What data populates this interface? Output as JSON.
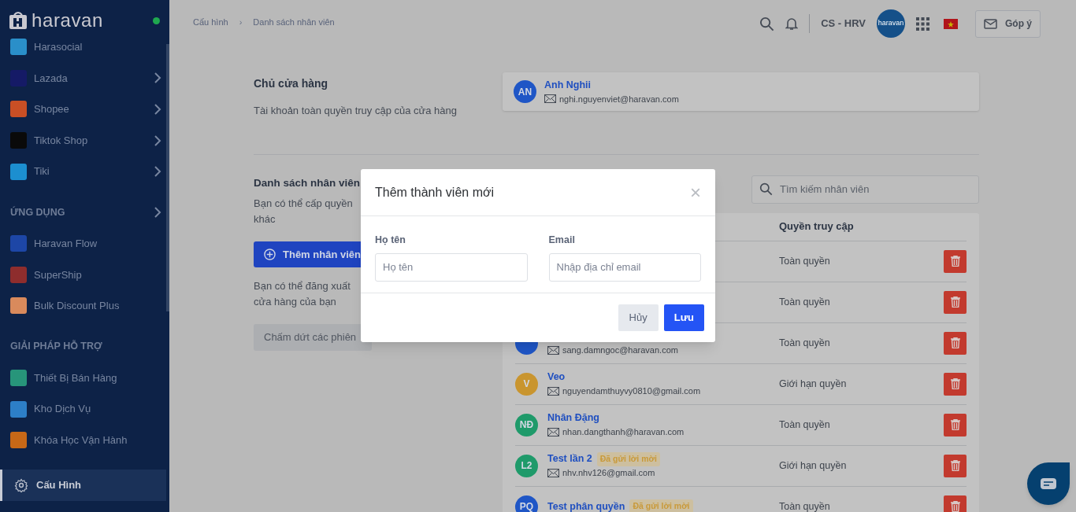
{
  "sidebar": {
    "logo": "haravan",
    "online": true,
    "items": [
      {
        "kind": "item",
        "label": "Harasocial",
        "color": "#2a8fc9",
        "chevron": false
      },
      {
        "kind": "item",
        "label": "Lazada",
        "color": "#151a66",
        "chevron": true
      },
      {
        "kind": "item",
        "label": "Shopee",
        "color": "#c94f25",
        "chevron": true
      },
      {
        "kind": "item",
        "label": "Tiktok Shop",
        "color": "#0a0a0a",
        "chevron": true
      },
      {
        "kind": "item",
        "label": "Tiki",
        "color": "#1c8fd0",
        "chevron": true
      },
      {
        "kind": "section",
        "label": "ỨNG DỤNG",
        "chevron": true
      },
      {
        "kind": "item",
        "label": "Haravan Flow",
        "color": "#1d46a6",
        "chevron": false
      },
      {
        "kind": "item",
        "label": "SuperShip",
        "color": "#8e2d2d",
        "chevron": false
      },
      {
        "kind": "item",
        "label": "Bulk Discount Plus",
        "color": "#d98a5c",
        "chevron": false
      },
      {
        "kind": "section",
        "label": "GIẢI PHÁP HỖ TRỢ",
        "chevron": false
      },
      {
        "kind": "item",
        "label": "Thiết Bị Bán Hàng",
        "color": "#27957a",
        "chevron": false
      },
      {
        "kind": "item",
        "label": "Kho Dịch Vụ",
        "color": "#2d7fc7",
        "chevron": false
      },
      {
        "kind": "item",
        "label": "Khóa Học Vận Hành",
        "color": "#c76817",
        "chevron": false
      }
    ],
    "settings": {
      "label": "Cấu Hình",
      "selected": true
    }
  },
  "breadcrumb": [
    "Cấu hình",
    "›",
    "Danh sách nhân viên"
  ],
  "header": {
    "account": "CS - HRV",
    "avatar_text": "haravan",
    "feedback": "Góp ý"
  },
  "owner": {
    "title": "Chủ cửa hàng",
    "description": "Tài khoản toàn quyền truy cập của cửa hàng",
    "initials": "AN",
    "name": "Anh Nghii",
    "email": "nghi.nguyenviet@haravan.com"
  },
  "staff": {
    "title": "Danh sách nhân viên",
    "description": "Bạn có thể cấp quyền",
    "description_2": "khác",
    "add_button": "Thêm nhân viên",
    "logout_text": "Bạn có thể đăng xuất",
    "logout_text_2": "cửa hàng của bạn",
    "end_sessions": "Chấm dứt các phiên",
    "search_placeholder": "Tìm kiếm nhân viên",
    "column": "Quyền truy cập",
    "rows": [
      {
        "access": "Toàn quyền"
      },
      {
        "access": "Toàn quyền"
      },
      {
        "email": "sang.damngoc@haravan.com",
        "access": "Toàn quyền",
        "color": "#1f56c6"
      },
      {
        "initials": "V",
        "name": "Veo",
        "email": "nguyendamthuyvy0810@gmail.com",
        "access": "Giới hạn quyền",
        "color": "#c9952f"
      },
      {
        "initials": "NĐ",
        "name": "Nhân Đặng",
        "email": "nhan.dangthanh@haravan.com",
        "access": "Toàn quyền",
        "color": "#1f9a6a"
      },
      {
        "initials": "L2",
        "name": "Test lần 2",
        "badge": "Đã gửi lời mời",
        "email": "nhv.nhv126@gmail.com",
        "access": "Giới hạn quyền",
        "color": "#1f9a6a"
      },
      {
        "initials": "PQ",
        "name": "Test phân quyền",
        "badge": "Đã gửi lời mời",
        "access": "Toàn quyền",
        "color": "#1f56c6"
      }
    ]
  },
  "modal": {
    "title": "Thêm thành viên mới",
    "close": "×",
    "fields": [
      {
        "label": "Họ tên",
        "placeholder": "Họ tên"
      },
      {
        "label": "Email",
        "placeholder": "Nhập địa chỉ email"
      }
    ],
    "cancel": "Hủy",
    "save": "Lưu"
  }
}
